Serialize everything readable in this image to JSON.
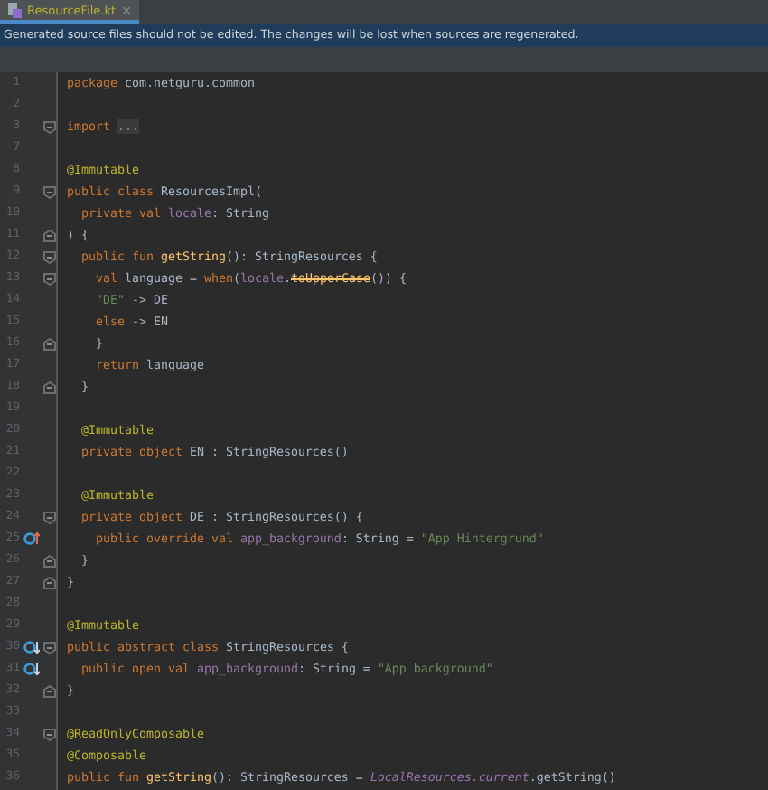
{
  "tab": {
    "label": "ResourceFile.kt",
    "close": "×",
    "selected": true
  },
  "banner": "Generated source files should not be edited. The changes will be lost when sources are regenerated.",
  "lines": [
    {
      "number": "1",
      "tokens": [
        {
          "kind": "kw",
          "text": "package "
        },
        {
          "kind": "plain",
          "text": "com.netguru.common"
        }
      ]
    },
    {
      "number": "2"
    },
    {
      "number": "3",
      "fold": {
        "kind": "start"
      },
      "tokens": [
        {
          "kind": "kw",
          "text": "import "
        },
        {
          "kind": "folded",
          "text": "..."
        }
      ]
    },
    {
      "number": "7"
    },
    {
      "number": "8",
      "tokens": [
        {
          "kind": "ann",
          "text": "@Immutable"
        }
      ]
    },
    {
      "number": "9",
      "fold": {
        "kind": "start"
      },
      "tokens": [
        {
          "kind": "kw",
          "text": "public class "
        },
        {
          "kind": "plain",
          "text": "ResourcesImpl("
        }
      ]
    },
    {
      "number": "10",
      "tokens": [
        {
          "kind": "kw",
          "text": "  private val "
        },
        {
          "kind": "prop",
          "text": "locale"
        },
        {
          "kind": "plain",
          "text": ": String"
        }
      ]
    },
    {
      "number": "11",
      "fold": {
        "kind": "end"
      },
      "tokens": [
        {
          "kind": "plain",
          "text": ") {"
        }
      ]
    },
    {
      "number": "12",
      "fold": {
        "kind": "start"
      },
      "tokens": [
        {
          "kind": "kw",
          "text": "  public fun "
        },
        {
          "kind": "fn",
          "text": "getString"
        },
        {
          "kind": "plain",
          "text": "(): StringResources {"
        }
      ]
    },
    {
      "number": "13",
      "fold": {
        "kind": "start"
      },
      "tokens": [
        {
          "kind": "kw",
          "text": "    val "
        },
        {
          "kind": "plain",
          "text": "language = "
        },
        {
          "kind": "kw",
          "text": "when"
        },
        {
          "kind": "plain",
          "text": "("
        },
        {
          "kind": "prop",
          "text": "locale"
        },
        {
          "kind": "plain",
          "text": "."
        },
        {
          "kind": "deprecated",
          "text": "toUpperCase"
        },
        {
          "kind": "plain",
          "text": "()) {"
        }
      ]
    },
    {
      "number": "14",
      "tokens": [
        {
          "kind": "str",
          "text": "    \"DE\""
        },
        {
          "kind": "plain",
          "text": " -> DE"
        }
      ]
    },
    {
      "number": "15",
      "tokens": [
        {
          "kind": "kw",
          "text": "    else"
        },
        {
          "kind": "plain",
          "text": " -> EN"
        }
      ]
    },
    {
      "number": "16",
      "fold": {
        "kind": "end"
      },
      "tokens": [
        {
          "kind": "plain",
          "text": "    }"
        }
      ]
    },
    {
      "number": "17",
      "tokens": [
        {
          "kind": "kw",
          "text": "    return "
        },
        {
          "kind": "plain",
          "text": "language"
        }
      ]
    },
    {
      "number": "18",
      "fold": {
        "kind": "end"
      },
      "tokens": [
        {
          "kind": "plain",
          "text": "  }"
        }
      ]
    },
    {
      "number": "19"
    },
    {
      "number": "20",
      "tokens": [
        {
          "kind": "ann",
          "text": "  @Immutable"
        }
      ]
    },
    {
      "number": "21",
      "tokens": [
        {
          "kind": "kw",
          "text": "  private object "
        },
        {
          "kind": "plain",
          "text": "EN : StringResources()"
        }
      ]
    },
    {
      "number": "22"
    },
    {
      "number": "23",
      "tokens": [
        {
          "kind": "ann",
          "text": "  @Immutable"
        }
      ]
    },
    {
      "number": "24",
      "fold": {
        "kind": "start"
      },
      "tokens": [
        {
          "kind": "kw",
          "text": "  private object "
        },
        {
          "kind": "plain",
          "text": "DE : StringResources() {"
        }
      ]
    },
    {
      "number": "25",
      "gutter": {
        "kind": "override"
      },
      "tokens": [
        {
          "kind": "kw",
          "text": "    public override val "
        },
        {
          "kind": "prop",
          "text": "app_background"
        },
        {
          "kind": "plain",
          "text": ": String = "
        },
        {
          "kind": "str",
          "text": "\"App Hintergrund\""
        }
      ]
    },
    {
      "number": "26",
      "fold": {
        "kind": "end"
      },
      "tokens": [
        {
          "kind": "plain",
          "text": "  }"
        }
      ]
    },
    {
      "number": "27",
      "fold": {
        "kind": "end"
      },
      "tokens": [
        {
          "kind": "plain",
          "text": "}"
        }
      ]
    },
    {
      "number": "28"
    },
    {
      "number": "29",
      "tokens": [
        {
          "kind": "ann",
          "text": "@Immutable"
        }
      ]
    },
    {
      "number": "30",
      "gutter": {
        "kind": "implemented"
      },
      "fold": {
        "kind": "start"
      },
      "tokens": [
        {
          "kind": "kw",
          "text": "public abstract class "
        },
        {
          "kind": "plain",
          "text": "StringResources {"
        }
      ]
    },
    {
      "number": "31",
      "gutter": {
        "kind": "implemented"
      },
      "tokens": [
        {
          "kind": "kw",
          "text": "  public open val "
        },
        {
          "kind": "prop",
          "text": "app_background"
        },
        {
          "kind": "plain",
          "text": ": String = "
        },
        {
          "kind": "str",
          "text": "\"App background\""
        }
      ]
    },
    {
      "number": "32",
      "fold": {
        "kind": "end"
      },
      "tokens": [
        {
          "kind": "plain",
          "text": "}"
        }
      ]
    },
    {
      "number": "33"
    },
    {
      "number": "34",
      "fold": {
        "kind": "start"
      },
      "tokens": [
        {
          "kind": "ann",
          "text": "@ReadOnlyComposable"
        }
      ]
    },
    {
      "number": "35",
      "tokens": [
        {
          "kind": "ann",
          "text": "@Composable"
        }
      ]
    },
    {
      "number": "36",
      "tokens": [
        {
          "kind": "kw",
          "text": "public fun "
        },
        {
          "kind": "fn",
          "text": "getString"
        },
        {
          "kind": "plain",
          "text": "(): StringResources = "
        },
        {
          "kind": "italic",
          "text": "LocalResources.current"
        },
        {
          "kind": "plain",
          "text": ".getString()"
        }
      ]
    }
  ]
}
